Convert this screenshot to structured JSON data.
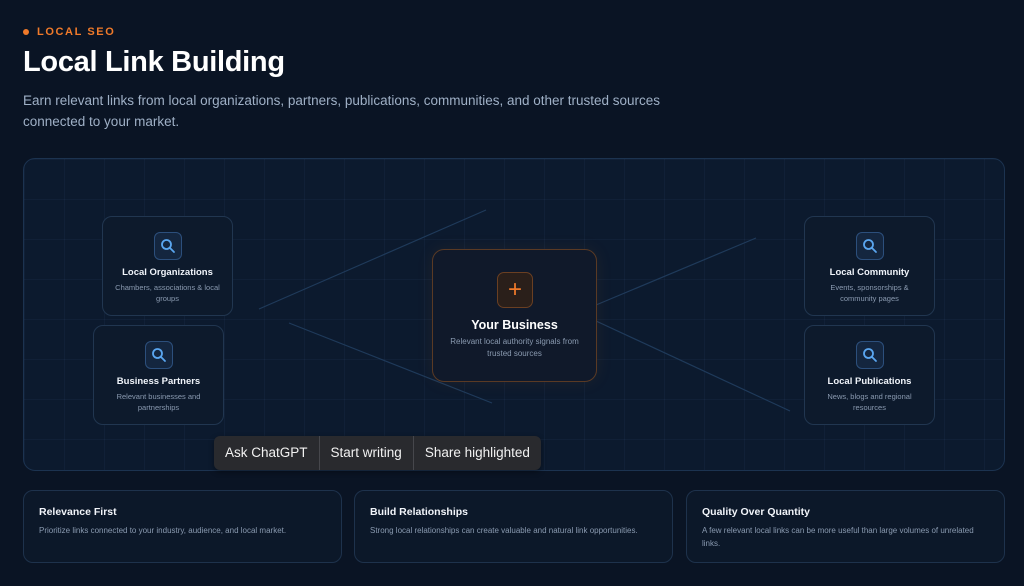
{
  "header": {
    "eyebrow": "LOCAL SEO",
    "title": "Local Link Building",
    "subtitle": "Earn relevant links from local organizations, partners, publications, communities, and other trusted sources connected to your market."
  },
  "diagram": {
    "center": {
      "icon": "plus-icon",
      "title": "Your Business",
      "desc": "Relevant local authority signals from trusted sources"
    },
    "nodes": [
      {
        "icon": "search-icon",
        "title": "Local Organizations",
        "desc": "Chambers, associations & local groups"
      },
      {
        "icon": "search-icon",
        "title": "Business Partners",
        "desc": "Relevant businesses and partnerships"
      },
      {
        "icon": "search-icon",
        "title": "Local Community",
        "desc": "Events, sponsorships & community pages"
      },
      {
        "icon": "search-icon",
        "title": "Local Publications",
        "desc": "News, blogs and regional resources"
      }
    ]
  },
  "selection_popup": {
    "ask": "Ask ChatGPT",
    "write": "Start writing",
    "share": "Share highlighted"
  },
  "cards": [
    {
      "title": "Relevance First",
      "desc": "Prioritize links connected to your industry, audience, and local market."
    },
    {
      "title": "Build Relationships",
      "desc": "Strong local relationships can create valuable and natural link opportunities."
    },
    {
      "title": "Quality Over Quantity",
      "desc": "A few relevant local links can be more useful than large volumes of unrelated links."
    }
  ],
  "colors": {
    "accent": "#f07a2a",
    "background": "#0a1424",
    "icon_blue": "#5aa6f0"
  }
}
